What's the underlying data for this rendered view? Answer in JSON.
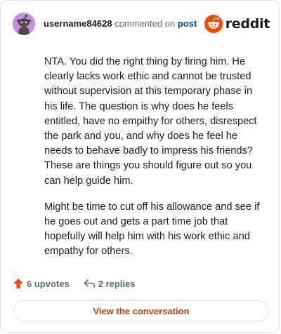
{
  "header": {
    "username": "username84628",
    "commented_on_text": "commented on",
    "post_link_label": "post",
    "avatar_icon": "snoo-avatar-icon",
    "logo_icon": "reddit-logo-icon",
    "logo_text": "reddit"
  },
  "comment": {
    "paragraphs": [
      "NTA. You did the right thing by firing him. He clearly lacks work ethic and cannot be trusted without supervision at this temporary phase in his life. The question is why does he feels entitled, have no empithy for others, disrespect the park and you, and why does he feel he needs to behave badly to impress his friends? These are things you should figure out so you can help guide him.",
      "Might be time to cut off his allowance and see if he goes out and gets a part time job that hopefully will help him with his work ethic and empathy for others."
    ]
  },
  "footer": {
    "upvotes_label": "6 upvotes",
    "upvote_icon": "upvote-arrow-icon",
    "replies_label": "2 replies",
    "reply_icon": "reply-arrow-icon"
  },
  "cta": {
    "label": "View the conversation"
  },
  "colors": {
    "brand_orange": "#ff4500",
    "cta_text": "#d93a00",
    "post_link": "#0a449b",
    "muted_text": "#576f76",
    "avatar_bg": "#c98ee0",
    "border": "#e1e3e5"
  }
}
